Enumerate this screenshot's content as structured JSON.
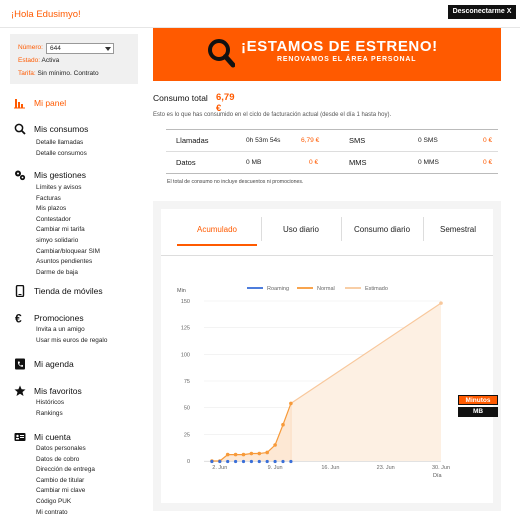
{
  "header": {
    "greeting": "¡Hola Edusimyo!",
    "logout_label": "Desconectarme X"
  },
  "account": {
    "number_label": "Número:",
    "number_value": "644",
    "status_label": "Estado:",
    "status_value": "Activa",
    "tariff_label": "Tarifa:",
    "tariff_value": "Sin mínimo. Contrato"
  },
  "sidebar": {
    "panel": "Mi panel",
    "consumos": {
      "title": "Mis consumos",
      "items": [
        "Detalle llamadas",
        "Detalle consumos"
      ]
    },
    "gestiones": {
      "title": "Mis gestiones",
      "items": [
        "Límites y avisos",
        "Facturas",
        "Mis plazos",
        "Contestador",
        "Cambiar mi tarifa",
        "simyo solidario",
        "Cambiar/bloquear SIM",
        "Asuntos pendientes",
        "Darme de baja"
      ]
    },
    "tienda": "Tienda de móviles",
    "promociones": {
      "title": "Promociones",
      "items": [
        "Invita a un amigo",
        "Usar mis euros de regalo"
      ]
    },
    "agenda": "Mi agenda",
    "favoritos": {
      "title": "Mis favoritos",
      "items": [
        "Históricos",
        "Rankings"
      ]
    },
    "cuenta": {
      "title": "Mi cuenta",
      "items": [
        "Datos personales",
        "Datos de cobro",
        "Dirección de entrega",
        "Cambio de titular",
        "Cambiar mi clave",
        "Código PUK",
        "Mi contrato"
      ]
    }
  },
  "banner": {
    "title": "¡ESTAMOS DE ESTRENO!",
    "subtitle": "RENOVAMOS EL ÁREA PERSONAL"
  },
  "consumo": {
    "title": "Consumo total",
    "value": "6,79 €",
    "description": "Esto es lo que has consumido en el ciclo de facturación actual (desde el día 1 hasta hoy).",
    "rows": [
      {
        "label": "Llamadas",
        "qty": "0h 53m 54s",
        "price": "6,79 €",
        "label2": "SMS",
        "qty2": "0 SMS",
        "price2": "0 €"
      },
      {
        "label": "Datos",
        "qty": "0 MB",
        "price": "0 €",
        "label2": "MMS",
        "qty2": "0 MMS",
        "price2": "0 €"
      }
    ],
    "note": "El total de consumo no incluye descuentos ni promociones."
  },
  "tabs": [
    "Acumulado",
    "Uso diario",
    "Consumo diario",
    "Semestral"
  ],
  "units": {
    "selected": "Minutos",
    "other": "MB"
  },
  "colors": {
    "accent": "#ff5a00",
    "roaming": "#3a6fd8",
    "normal": "#f79a3a",
    "estimado": "#f8c89c"
  },
  "chart_data": {
    "type": "line",
    "ylabel": "Min",
    "xlabel": "Día",
    "ylim": [
      0,
      150
    ],
    "xlim": [
      0,
      30
    ],
    "yticks": [
      0,
      25,
      50,
      75,
      100,
      125,
      150
    ],
    "xticks": [
      {
        "x": 2,
        "label": "2. Jun"
      },
      {
        "x": 9,
        "label": "9. Jun"
      },
      {
        "x": 16,
        "label": "16. Jun"
      },
      {
        "x": 23,
        "label": "23. Jun"
      },
      {
        "x": 30,
        "label": "30. Jun"
      }
    ],
    "legend": [
      "Roaming",
      "Normal",
      "Estimado"
    ],
    "series": [
      {
        "name": "Roaming",
        "x": [
          1,
          2,
          3,
          4,
          5,
          6,
          7,
          8,
          9,
          10,
          11
        ],
        "values": [
          0,
          0,
          0,
          0,
          0,
          0,
          0,
          0,
          0,
          0,
          0
        ]
      },
      {
        "name": "Normal",
        "x": [
          1,
          2,
          3,
          4,
          5,
          6,
          7,
          8,
          9,
          10,
          11
        ],
        "values": [
          0,
          0,
          6,
          6,
          6,
          7,
          7,
          8,
          15,
          34,
          54
        ]
      },
      {
        "name": "Estimado",
        "x": [
          11,
          30
        ],
        "values": [
          54,
          148
        ]
      }
    ]
  }
}
